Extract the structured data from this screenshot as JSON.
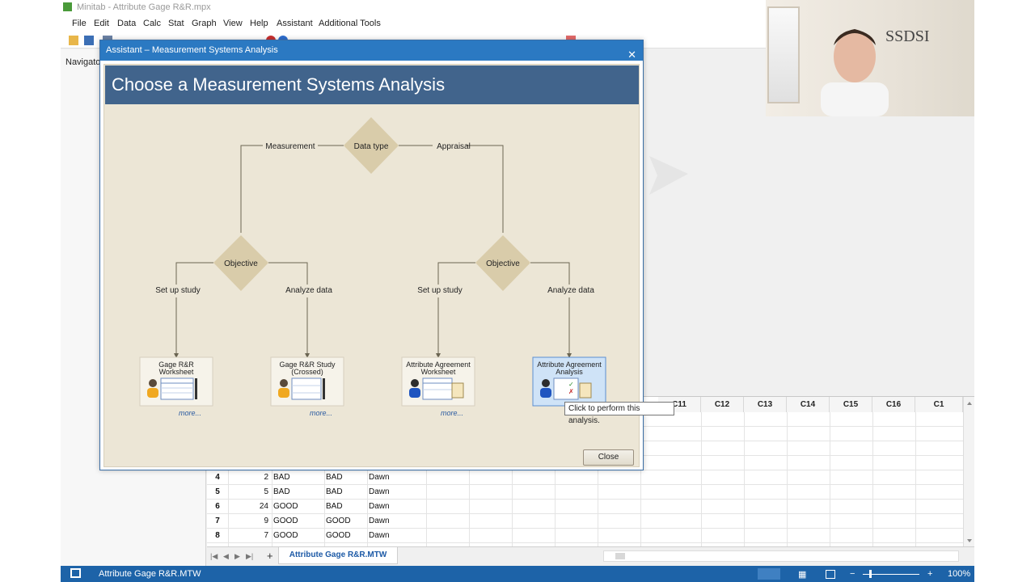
{
  "app": {
    "title": "Minitab - Attribute Gage R&R.mpx",
    "menu": [
      "File",
      "Edit",
      "Data",
      "Calc",
      "Stat",
      "Graph",
      "View",
      "Help",
      "Assistant",
      "Additional Tools"
    ],
    "navigator_label": "Navigato"
  },
  "dialog": {
    "title": "Assistant – Measurement Systems Analysis",
    "header": "Choose a Measurement Systems Analysis",
    "nodes": {
      "root": "Data type",
      "left_branch": "Measurement",
      "right_branch": "Appraisal",
      "objective_left": "Objective",
      "objective_right": "Objective",
      "setup_left": "Set up study",
      "analyze_left": "Analyze data",
      "setup_right": "Set up study",
      "analyze_right": "Analyze data"
    },
    "tools": [
      {
        "title_line1": "Gage R&R",
        "title_line2": "Worksheet",
        "more": "more..."
      },
      {
        "title_line1": "Gage R&R Study",
        "title_line2": "(Crossed)",
        "more": "more..."
      },
      {
        "title_line1": "Attribute Agreement",
        "title_line2": "Worksheet",
        "more": "more..."
      },
      {
        "title_line1": "Attribute Agreement",
        "title_line2": "Analysis",
        "more": ""
      }
    ],
    "close_label": "Close",
    "tooltip": "Click to perform this analysis."
  },
  "worksheet": {
    "columns": [
      "C11",
      "C12",
      "C13",
      "C14",
      "C15",
      "C16",
      "C1"
    ],
    "rows": [
      {
        "n": "4",
        "a": "2",
        "b": "BAD",
        "c": "BAD",
        "d": "Dawn"
      },
      {
        "n": "5",
        "a": "5",
        "b": "BAD",
        "c": "BAD",
        "d": "Dawn"
      },
      {
        "n": "6",
        "a": "24",
        "b": "GOOD",
        "c": "BAD",
        "d": "Dawn"
      },
      {
        "n": "7",
        "a": "9",
        "b": "GOOD",
        "c": "GOOD",
        "d": "Dawn"
      },
      {
        "n": "8",
        "a": "7",
        "b": "GOOD",
        "c": "GOOD",
        "d": "Dawn"
      }
    ],
    "tab": "Attribute Gage R&R.MTW"
  },
  "statusbar": {
    "file": "Attribute Gage R&R.MTW",
    "zoom": "100%"
  },
  "webcam": {
    "logo": "SSDSI"
  },
  "colors": {
    "dialog_header": "#41648c",
    "dialog_bg": "#ece6d6",
    "diamond": "#d9ccaa",
    "statusbar": "#1d63a8",
    "titlebar": "#2b79c2"
  }
}
